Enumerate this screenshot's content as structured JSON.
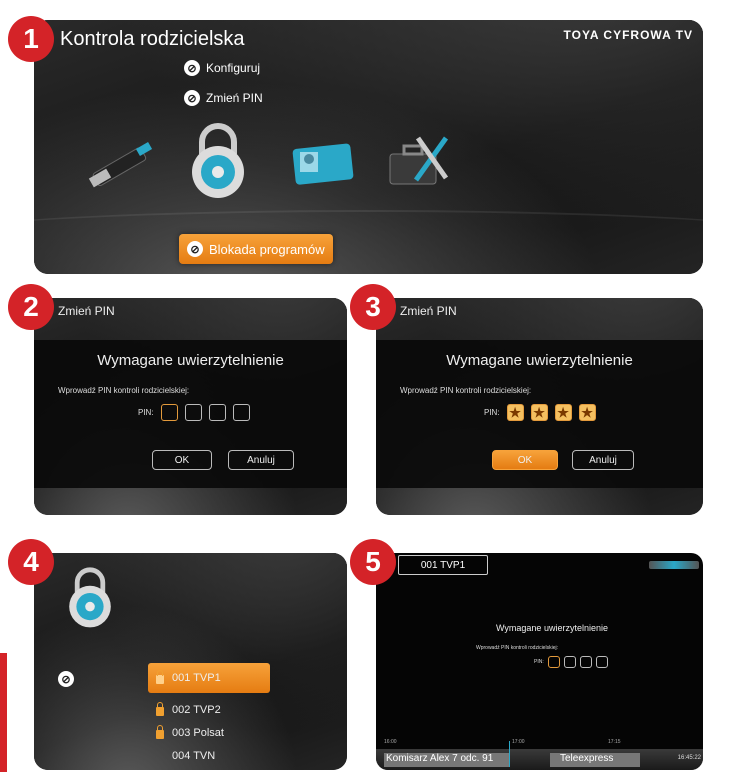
{
  "badges": [
    "1",
    "2",
    "3",
    "4",
    "5"
  ],
  "panel1": {
    "title": "Kontrola rodzicielska",
    "brand": "TOYA CYFROWA TV",
    "menu": [
      "Konfiguruj",
      "Zmień PIN"
    ],
    "selected": "Blokada programów",
    "icons": [
      "usb-stick-icon",
      "padlock-icon",
      "id-card-icon",
      "toolbox-icon"
    ]
  },
  "panel2": {
    "header": "Zmień PIN",
    "dialog_title": "Wymagane uwierzytelnienie",
    "prompt": "Wprowadź PIN kontroli rodzicielskiej:",
    "pin_label": "PIN:",
    "ok": "OK",
    "cancel": "Anuluj"
  },
  "panel3": {
    "header": "Zmień PIN",
    "dialog_title": "Wymagane uwierzytelnienie",
    "prompt": "Wprowadź PIN kontroli rodzicielskiej:",
    "pin_label": "PIN:",
    "pin_mask": "★",
    "ok": "OK",
    "cancel": "Anuluj"
  },
  "panel4": {
    "channels": [
      "001 TVP1",
      "002 TVP2",
      "003 Polsat",
      "004 TVN"
    ],
    "locked": [
      true,
      true,
      true,
      false
    ]
  },
  "panel5": {
    "channel": "001 TVP1",
    "dialog_title": "Wymagane uwierzytelnienie",
    "prompt": "Wprowadź PIN kontroli rodzicielskiej:",
    "pin_label": "PIN:",
    "times": [
      "16:00",
      "17:00",
      "17:15"
    ],
    "programs": [
      "Komisarz Alex 7 odc. 91",
      "Teleexpress"
    ],
    "clock": "16:45:22"
  }
}
